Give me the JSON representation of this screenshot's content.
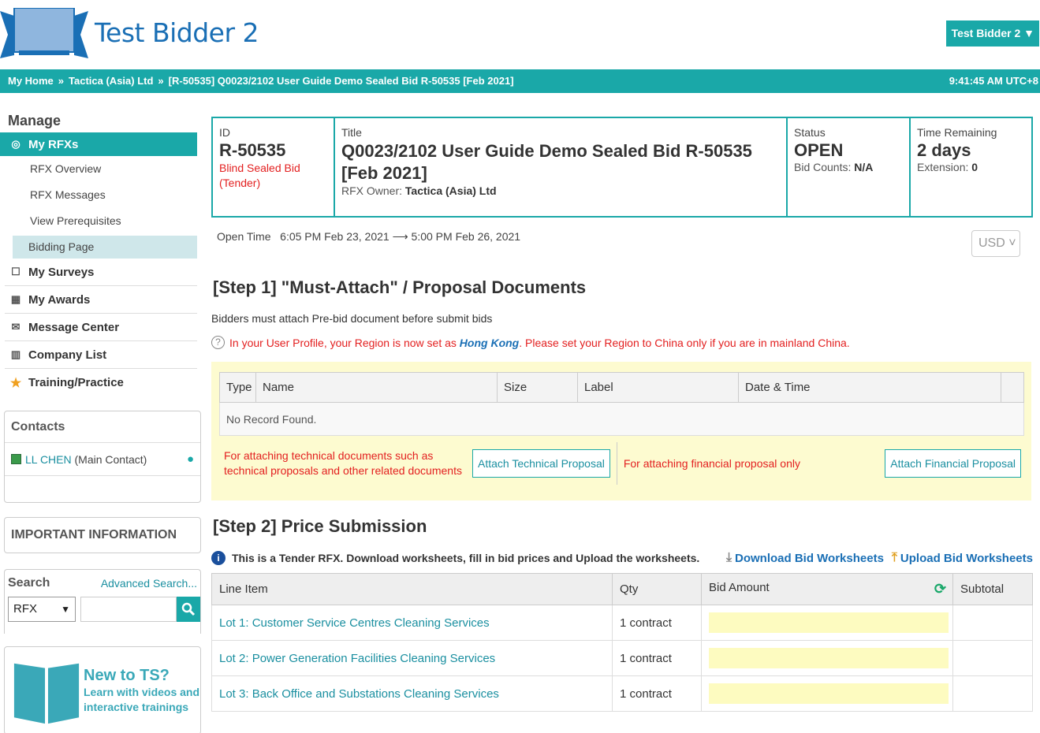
{
  "header": {
    "app_title": "Test Bidder 2",
    "user_menu": "Test Bidder 2 ▼"
  },
  "breadcrumb": {
    "items": [
      "My Home",
      "Tactica (Asia) Ltd",
      "[R-50535] Q0023/2102 User Guide Demo Sealed Bid R-50535 [Feb 2021]"
    ],
    "separator": "»",
    "clock": "9:41:45 AM UTC+8"
  },
  "sidebar": {
    "manage_heading": "Manage",
    "my_rfxs": "My RFXs",
    "sub_items": [
      "RFX Overview",
      "RFX Messages",
      "View Prerequisites",
      "Bidding Page"
    ],
    "nav_items": [
      "My Surveys",
      "My Awards",
      "Message Center",
      "Company List",
      "Training/Practice"
    ],
    "contacts_heading": "Contacts",
    "contact_name": "LL CHEN",
    "contact_role": " (Main Contact)",
    "important_heading": "IMPORTANT INFORMATION",
    "search_label": "Search",
    "advanced_search": "Advanced Search...",
    "search_type": "RFX",
    "search_placeholder": "",
    "promo_title": "New to TS?",
    "promo_text": "Learn with videos and interactive trainings"
  },
  "rfx": {
    "id_label": "ID",
    "id_value": "R-50535",
    "type": "Blind Sealed Bid (Tender)",
    "title_label": "Title",
    "title_value": "Q0023/2102 User Guide Demo Sealed Bid R-50535 [Feb 2021]",
    "owner_label": "RFX Owner: ",
    "owner_value": "Tactica (Asia) Ltd",
    "status_label": "Status",
    "status_value": "OPEN",
    "bid_counts_label": "Bid Counts: ",
    "bid_counts_value": "N/A",
    "time_label": "Time Remaining",
    "time_value": "2 days",
    "extension_label": "Extension: ",
    "extension_value": "0",
    "open_time_label": "Open Time",
    "open_time_value": "6:05 PM Feb 23, 2021 ⟶ 5:00 PM Feb 26, 2021",
    "currency": "USD ˅"
  },
  "step1": {
    "title": "[Step 1] \"Must-Attach\" / Proposal Documents",
    "note": "Bidders must attach Pre-bid document before submit bids",
    "region_pre": "In your User Profile, your Region is now set as ",
    "region_value": "Hong Kong",
    "region_post": ". Please set your Region to China only if you are in mainland China.",
    "columns": [
      "Type",
      "Name",
      "Size",
      "Label",
      "Date & Time",
      ""
    ],
    "empty_text": "No Record Found.",
    "tech_text": "For attaching technical documents such as technical proposals and other related documents",
    "tech_button": "Attach Technical Proposal",
    "fin_text": "For attaching financial proposal only",
    "fin_button": "Attach Financial Proposal"
  },
  "step2": {
    "title": "[Step 2] Price Submission",
    "note": "This is a Tender RFX. Download worksheets, fill in bid prices and Upload the worksheets.",
    "download": "Download Bid Worksheets",
    "upload": "Upload Bid Worksheets",
    "columns": [
      "Line Item",
      "Qty",
      "Bid Amount",
      "Subtotal"
    ],
    "rows": [
      {
        "item": "Lot 1: Customer Service Centres Cleaning Services",
        "qty": "1 contract"
      },
      {
        "item": "Lot 2: Power Generation Facilities Cleaning Services",
        "qty": "1 contract"
      },
      {
        "item": "Lot 3: Back Office and Substations Cleaning Services",
        "qty": "1 contract"
      }
    ]
  },
  "colors": {
    "accent": "#1aa8a8",
    "brand_blue": "#1a6fb5",
    "warning_red": "#e32020",
    "highlight_yellow": "#fdfbd0"
  }
}
